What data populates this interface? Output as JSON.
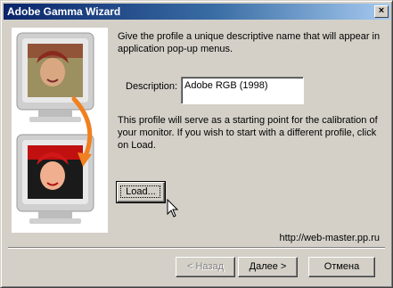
{
  "window": {
    "title": "Adobe Gamma Wizard",
    "close_glyph": "×"
  },
  "content": {
    "intro": "Give the profile a unique descriptive name that will appear in application pop-up menus.",
    "description_label": "Description:",
    "description_value": "Adobe RGB (1998)",
    "info": "This profile will serve as a starting point for the calibration of your monitor. If you wish to start with a different profile, click on Load.",
    "load_label": "Load..."
  },
  "footer": {
    "url": "http://web-master.pp.ru",
    "back_label": "< Назад",
    "next_label": "Далее >",
    "cancel_label": "Отмена"
  },
  "icons": {
    "illustration": "monitor-face-illustration-icon",
    "cursor": "mouse-pointer-icon",
    "arrow": "curved-arrow-icon"
  },
  "colors": {
    "titlebar_start": "#0a246a",
    "titlebar_end": "#a6caf0",
    "dialog_face": "#d4d0c8",
    "arrow": "#f08020"
  }
}
